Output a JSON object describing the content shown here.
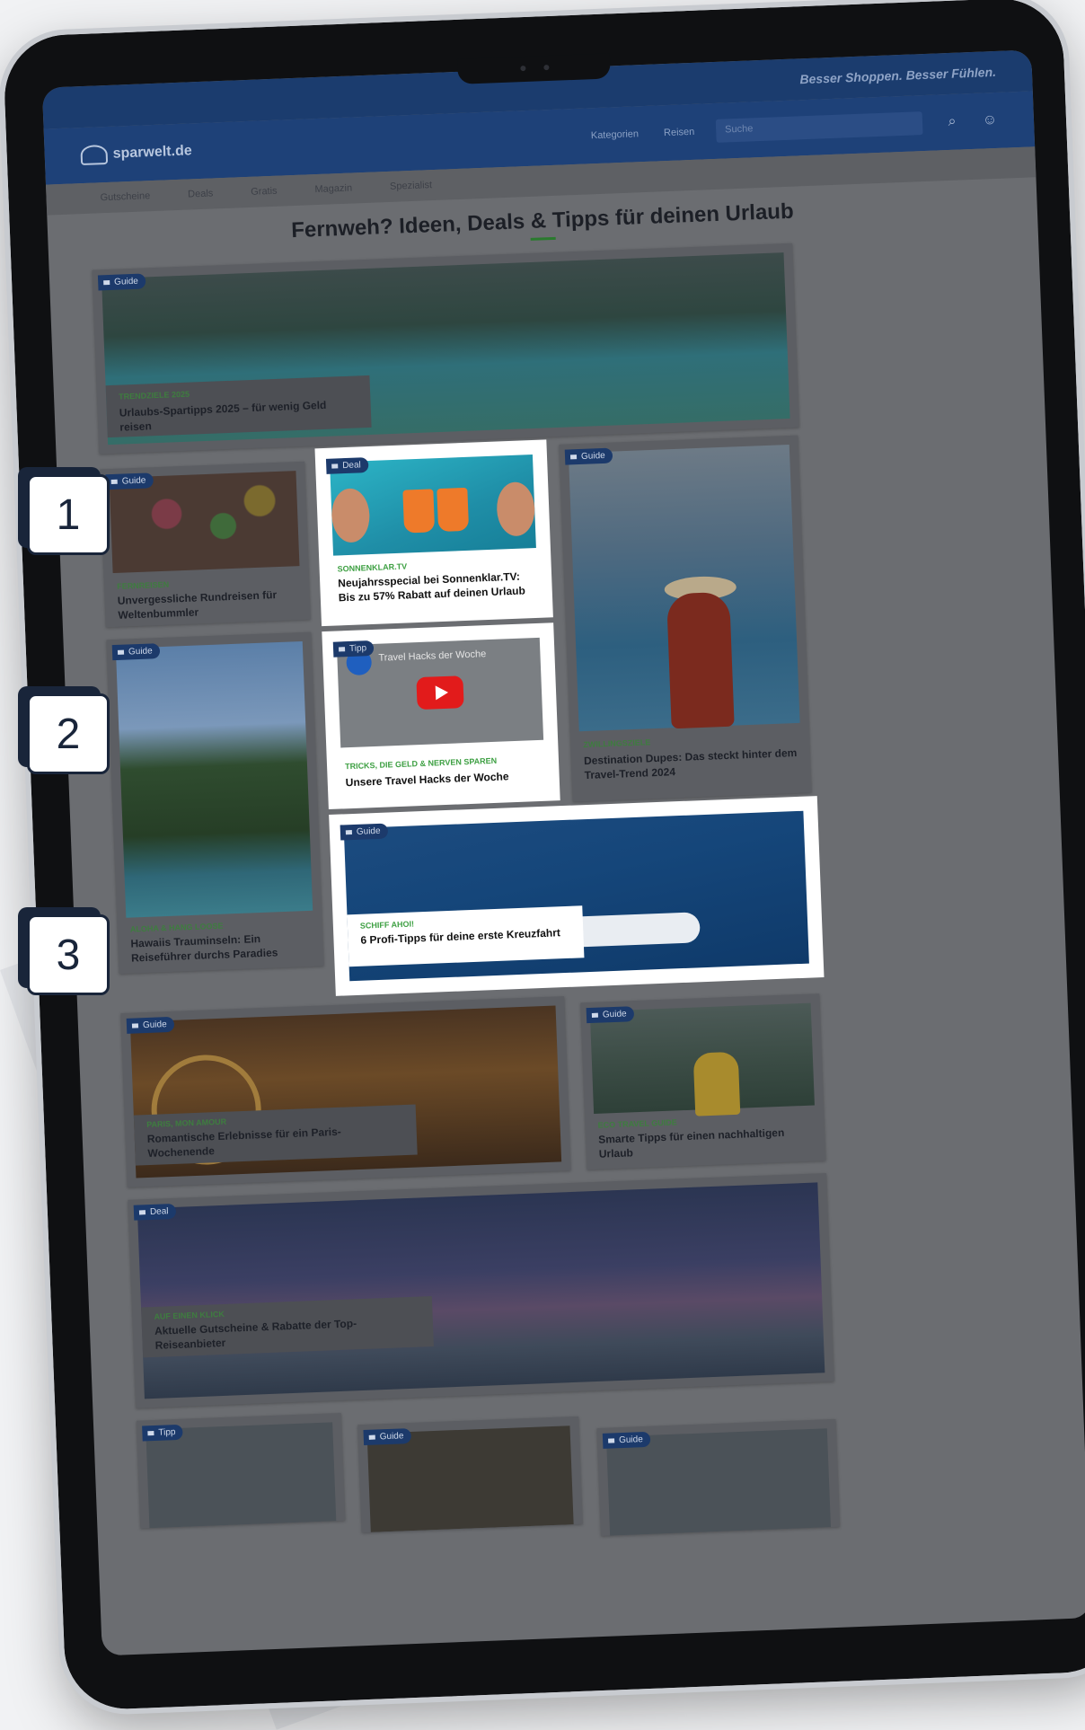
{
  "site": {
    "tagline": "Besser Shoppen. Besser Fühlen.",
    "logo": "sparwelt.de",
    "search_placeholder": "Suche",
    "nav_main": [
      "Gutscheine",
      "Deals",
      "Gratis",
      "Magazin",
      "Spezialist",
      "Kategorien",
      "Reisen"
    ],
    "subnav": [
      "Gutscheine",
      "Deals",
      "Gratis",
      "Magazin",
      "Spezialist"
    ]
  },
  "page": {
    "title": "Fernweh? Ideen, Deals & Tipps für deinen Urlaub"
  },
  "cards": {
    "hero": {
      "badge": "Guide",
      "kicker": "TRENDZIELE 2025",
      "headline": "Urlaubs-Spartipps 2025 – für wenig Geld reisen"
    },
    "market": {
      "badge": "Guide",
      "kicker": "FERNREISEN",
      "headline": "Unvergessliche Rundreisen für Weltenbummler"
    },
    "sonnenklar": {
      "badge": "Deal",
      "kicker": "SONNENKLAR.TV",
      "headline": "Neujahrsspecial bei Sonnenklar.TV: Bis zu 57% Rabatt auf deinen Urlaub"
    },
    "dupes": {
      "badge": "Guide",
      "kicker": "ZWILLINGSZIELE",
      "headline": "Destination Dupes: Das steckt hinter dem Travel-Trend 2024"
    },
    "hawaii": {
      "badge": "Guide",
      "kicker": "ALOHA & HANG LOOSE",
      "headline": "Hawaiis Trauminseln: Ein Reiseführer durchs Paradies"
    },
    "hacks": {
      "badge": "Tipp",
      "kicker": "TRICKS, DIE GELD & NERVEN SPAREN",
      "headline": "Unsere Travel Hacks der Woche",
      "video_title": "Travel Hacks der Woche"
    },
    "cruise": {
      "badge": "Guide",
      "kicker": "SCHIFF AHOI!",
      "headline": "6 Profi-Tipps für deine erste Kreuzfahrt"
    },
    "paris": {
      "badge": "Guide",
      "kicker": "PARIS, MON AMOUR",
      "headline": "Romantische Erlebnisse für ein Paris-Wochenende"
    },
    "eco": {
      "badge": "Guide",
      "kicker": "ECO TRAVEL GUIDE",
      "headline": "Smarte Tipps für einen nachhaltigen Urlaub"
    },
    "vouchers": {
      "badge": "Deal",
      "kicker": "AUF EINEN KLICK",
      "headline": "Aktuelle Gutscheine & Rabatte der Top-Reiseanbieter"
    },
    "bottom1": {
      "badge": "Tipp"
    },
    "bottom2": {
      "badge": "Guide"
    },
    "bottom3": {
      "badge": "Guide"
    }
  },
  "callouts": [
    "1",
    "2",
    "3"
  ],
  "colors": {
    "header_blue": "#1e4178",
    "accent_green": "#3ea043",
    "badge_blue": "#1c3a6b"
  }
}
